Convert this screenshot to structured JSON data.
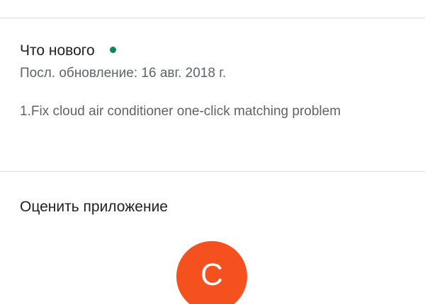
{
  "whats_new": {
    "title": "Что нового",
    "updated": "Посл. обновление: 16 авг. 2018 г.",
    "notes": "1.Fix cloud air conditioner one-click matching problem"
  },
  "rate": {
    "title": "Оценить приложение",
    "avatar_letter": "C"
  },
  "colors": {
    "new_indicator": "#01875f",
    "avatar_bg": "#f4511e",
    "primary_text": "#212121",
    "secondary_text": "#5f6368"
  }
}
